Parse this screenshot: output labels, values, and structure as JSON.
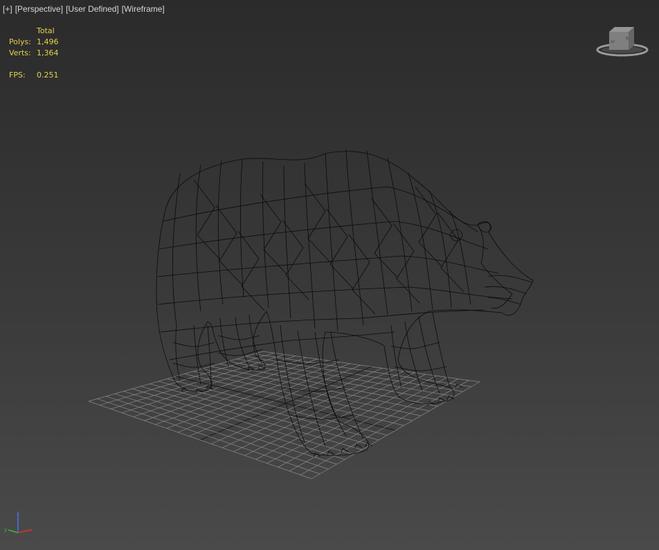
{
  "viewport": {
    "labels": [
      "[+]",
      "[Perspective]",
      "[User Defined]",
      "[Wireframe]"
    ]
  },
  "stats": {
    "header": "Total",
    "polys_label": "Polys:",
    "polys_value": "1,496",
    "verts_label": "Verts:",
    "verts_value": "1,364",
    "fps_label": "FPS:",
    "fps_value": "0.251"
  },
  "viewcube": {
    "front_label": "Front",
    "left_label": "Left"
  },
  "gizmo": {
    "x_label": "x",
    "y_label": "y",
    "z_label": "z"
  },
  "colors": {
    "stats_text": "#e6d24a",
    "label_text": "#d8d8d8",
    "grid": "#8a8a8a",
    "wire": "#0a0a0a"
  },
  "icons": [
    "viewcube-icon",
    "axis-gizmo-icon"
  ]
}
